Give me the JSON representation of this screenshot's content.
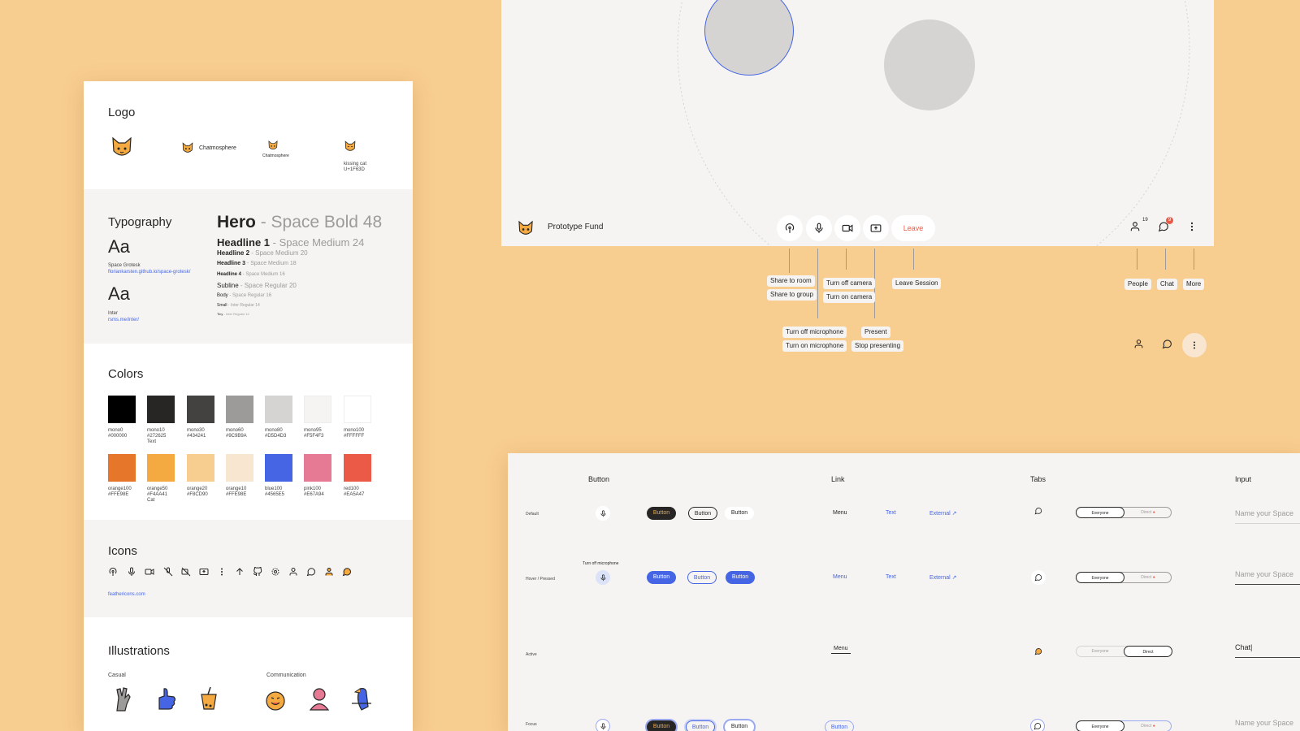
{
  "guide": {
    "logo": {
      "title": "Logo",
      "wordmark_a": "Chatmosphere",
      "wordmark_b": "Chatmosphere",
      "emoji_name": "kissing cat",
      "emoji_code": "U+1F63D"
    },
    "typography": {
      "title": "Typography",
      "font1": {
        "sample": "Aa",
        "name": "Space Grotesk",
        "url": "floriankarsten.github.io/space-grotesk/"
      },
      "font2": {
        "sample": "Aa",
        "name": "Inter",
        "url": "rsms.me/inter/"
      },
      "scale": [
        {
          "name": "Hero",
          "spec": "- Space Bold 48"
        },
        {
          "name": "Headline 1",
          "spec": "- Space Medium 24"
        },
        {
          "name": "Headline 2",
          "spec": "- Space Medium 20"
        },
        {
          "name": "Headline 3",
          "spec": "- Space Medium 18"
        },
        {
          "name": "Headline 4",
          "spec": "- Space Medium 16"
        },
        {
          "name": "Subline",
          "spec": "- Space Regular 20"
        },
        {
          "name": "Body",
          "spec": "- Space Regular 16"
        },
        {
          "name": "Small",
          "spec": "- Inter Regular 14"
        },
        {
          "name": "Tiny",
          "spec": "- Inter Regular 12"
        }
      ]
    },
    "colors": {
      "title": "Colors",
      "mono": [
        {
          "name": "mono0",
          "hex": "#000000",
          "note": ""
        },
        {
          "name": "mono10",
          "hex": "#272625",
          "note": "Text"
        },
        {
          "name": "mono30",
          "hex": "#434241",
          "note": ""
        },
        {
          "name": "mono60",
          "hex": "#9C9B9A",
          "note": ""
        },
        {
          "name": "mono80",
          "hex": "#D5D4D3",
          "note": ""
        },
        {
          "name": "mono95",
          "hex": "#F5F4F3",
          "note": ""
        },
        {
          "name": "mono100",
          "hex": "#FFFFFF",
          "note": ""
        }
      ],
      "accent": [
        {
          "name": "orange100",
          "hex": "#FFE98E",
          "note": "",
          "swatch": "#E5762A"
        },
        {
          "name": "orange50",
          "hex": "#F4AA41",
          "note": "Cat",
          "swatch": "#F4AA41"
        },
        {
          "name": "orange20",
          "hex": "#F8CD90",
          "note": "",
          "swatch": "#F8CD90"
        },
        {
          "name": "orange10",
          "hex": "#FFE98E",
          "note": "",
          "swatch": "#F8E6D1"
        },
        {
          "name": "blue100",
          "hex": "#4565E5",
          "note": "",
          "swatch": "#4565E5"
        },
        {
          "name": "pink100",
          "hex": "#E67A94",
          "note": "",
          "swatch": "#E67A94"
        },
        {
          "name": "red100",
          "hex": "#EA5A47",
          "note": "",
          "swatch": "#EA5A47"
        }
      ]
    },
    "icons": {
      "title": "Icons",
      "link": "feathericons.com"
    },
    "illustrations": {
      "title": "Illustrations",
      "casual": "Casual",
      "communication": "Communication"
    }
  },
  "call": {
    "room_name": "Prototype Fund",
    "leave_label": "Leave",
    "people_count": "19",
    "chat_badge": "9",
    "tooltips": {
      "share_room": "Share to room",
      "share_group": "Share to group",
      "mic_off": "Turn off microphone",
      "mic_on": "Turn on microphone",
      "cam_off": "Turn off camera",
      "cam_on": "Turn on camera",
      "present": "Present",
      "stop_present": "Stop presenting",
      "leave": "Leave Session",
      "people": "People",
      "chat": "Chat",
      "more": "More"
    }
  },
  "components": {
    "headers": {
      "button": "Button",
      "link": "Link",
      "tabs": "Tabs",
      "input": "Input"
    },
    "rows": {
      "default": "Default",
      "hover": "Hover / Pressed",
      "active": "Active",
      "focus": "Focus"
    },
    "button_label": "Button",
    "mic_tooltip": "Turn off microphone",
    "link_menu": "Menu",
    "link_text": "Text",
    "link_external": "External",
    "tab_everyone": "Everyone",
    "tab_direct": "Direct",
    "input_placeholder": "Name your Space",
    "input_value": "Chat"
  }
}
